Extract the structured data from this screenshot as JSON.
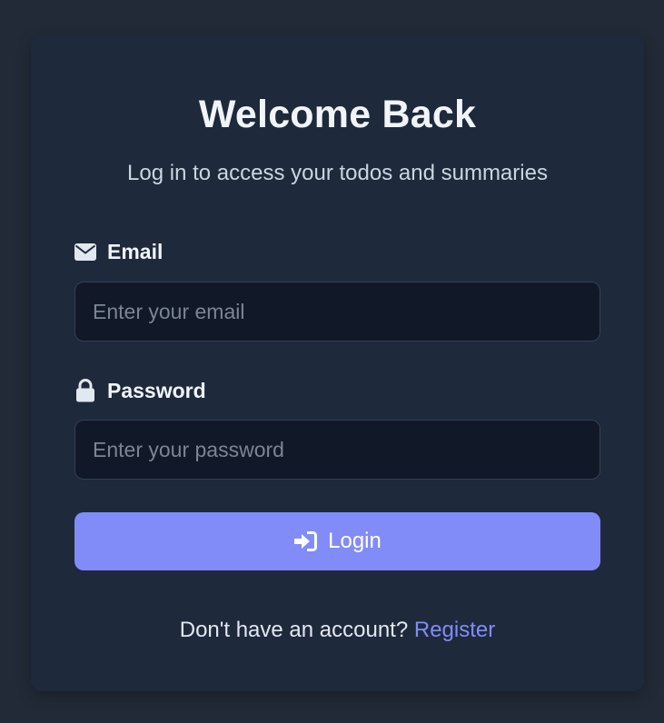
{
  "login": {
    "title": "Welcome Back",
    "subtitle": "Log in to access your todos and summaries",
    "email": {
      "label": "Email",
      "icon": "envelope-icon",
      "placeholder": "Enter your email",
      "value": ""
    },
    "password": {
      "label": "Password",
      "icon": "lock-icon",
      "placeholder": "Enter your password",
      "value": ""
    },
    "button": {
      "label": "Login",
      "icon": "sign-in-icon"
    },
    "footer": {
      "prompt": "Don't have an account?",
      "link": "Register"
    }
  },
  "colors": {
    "page_background": "#222a37",
    "card_background": "#1e293b",
    "input_background": "#111827",
    "accent": "#818cf8",
    "text_primary": "#f1f5f9",
    "text_secondary": "#cbd5e1",
    "placeholder": "#7b8595"
  }
}
